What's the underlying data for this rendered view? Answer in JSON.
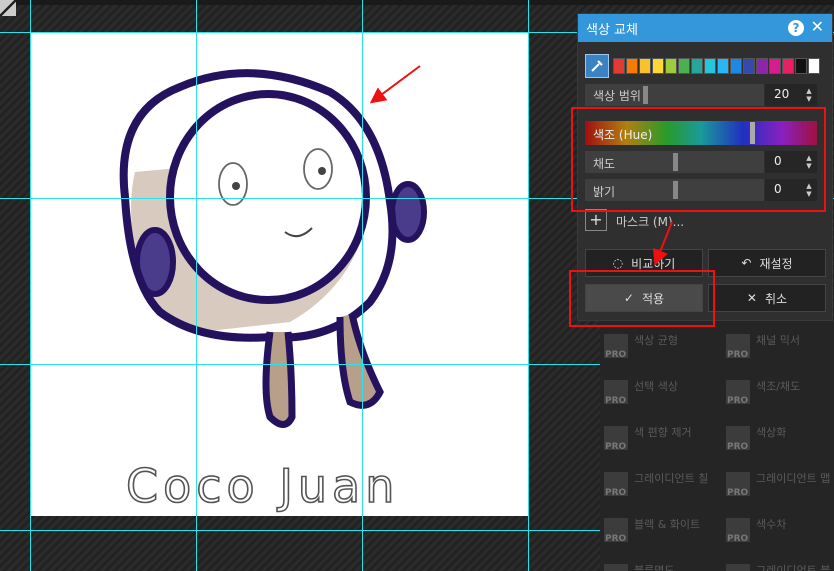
{
  "dialog": {
    "title": "색상 교체",
    "help_label": "?",
    "close_label": "✕",
    "swatches": [
      "#e53935",
      "#f57c00",
      "#fbc02d",
      "#fdd835",
      "#9ccc3c",
      "#4caf50",
      "#26a69a",
      "#26c6da",
      "#29b6f6",
      "#1e88e5",
      "#3949ab",
      "#8e24aa",
      "#d81b90",
      "#e91e63",
      "#111111",
      "#ffffff"
    ],
    "range": {
      "label": "색상 범위",
      "value": "20"
    },
    "hue": {
      "label": "색조 (Hue)",
      "fraction": 0.72
    },
    "saturation": {
      "label": "채도",
      "value": "0"
    },
    "brightness": {
      "label": "밝기",
      "value": "0"
    },
    "mask": {
      "label": "마스크 (M)...",
      "plus": "+"
    },
    "compare_label": "비교하기",
    "reset_label": "재설정",
    "apply_label": "적용",
    "cancel_label": "취소"
  },
  "drawing": {
    "signature": "Coco Juan"
  },
  "tools": [
    {
      "label": "색상 균형",
      "icon": "color-balance-icon"
    },
    {
      "label": "채널 믹서",
      "icon": "channel-mixer-icon"
    },
    {
      "label": "선택 색상",
      "icon": "selective-color-icon"
    },
    {
      "label": "색조/채도",
      "icon": "hue-saturation-icon"
    },
    {
      "label": "색 편향 제거",
      "icon": "remove-color-cast-icon"
    },
    {
      "label": "색상화",
      "icon": "colorize-icon"
    },
    {
      "label": "그레이디언트 칠",
      "icon": "gradient-fill-icon"
    },
    {
      "label": "그레이디언트 맵",
      "icon": "gradient-map-icon"
    },
    {
      "label": "블랙 & 화이트",
      "icon": "black-white-icon"
    },
    {
      "label": "색수차",
      "icon": "chromatic-aberration-icon"
    },
    {
      "label": "블루명도",
      "icon": "blue-brightness-icon"
    },
    {
      "label": "그레이디언트 블루명도",
      "icon": "gradient-blue-brightness-icon"
    }
  ],
  "pro_badge": "PRO"
}
